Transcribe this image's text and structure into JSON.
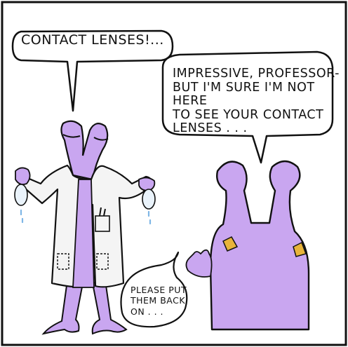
{
  "speech_bubbles": {
    "professor": "CONTACT LENSES!...",
    "visitor": "IMPRESSIVE, PROFESSOR-\nBUT I'M SURE I'M NOT HERE\nTO SEE YOUR CONTACT\nLENSES . . .",
    "visitor_followup": "PLEASE PUT\nTHEM BACK\nON . . ."
  },
  "colors": {
    "alien_purple": "#c9a6f0",
    "coat_white": "#f4f4f4",
    "outline": "#111111",
    "epaulette_gold": "#e8b43a",
    "water_drop": "#7fb6e6"
  }
}
